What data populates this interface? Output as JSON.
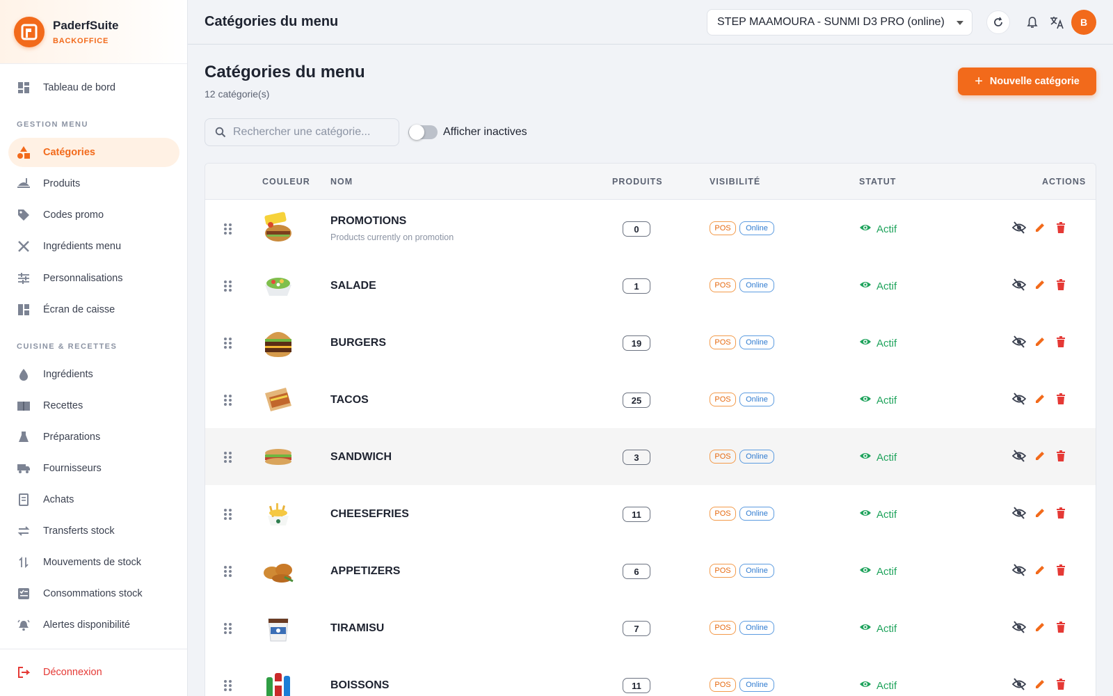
{
  "app": {
    "name": "PaderfSuite",
    "subtitle": "BACKOFFICE",
    "accent": "#f26a1b"
  },
  "sidebar": {
    "top_item": {
      "label": "Tableau de bord",
      "icon": "dashboard-icon"
    },
    "sections": [
      {
        "title": "GESTION MENU",
        "items": [
          {
            "label": "Catégories",
            "icon": "shapes-icon",
            "active": true
          },
          {
            "label": "Produits",
            "icon": "food-tray-icon"
          },
          {
            "label": "Codes promo",
            "icon": "tag-icon"
          },
          {
            "label": "Ingrédients menu",
            "icon": "utensils-icon"
          },
          {
            "label": "Personnalisations",
            "icon": "tune-icon"
          },
          {
            "label": "Écran de caisse",
            "icon": "layout-icon"
          }
        ]
      },
      {
        "title": "CUISINE & RECETTES",
        "items": [
          {
            "label": "Ingrédients",
            "icon": "drop-icon"
          },
          {
            "label": "Recettes",
            "icon": "book-icon"
          },
          {
            "label": "Préparations",
            "icon": "flask-icon"
          },
          {
            "label": "Fournisseurs",
            "icon": "truck-icon"
          },
          {
            "label": "Achats",
            "icon": "receipt-icon"
          },
          {
            "label": "Transferts stock",
            "icon": "swap-icon"
          },
          {
            "label": "Mouvements de stock",
            "icon": "arrows-vertical-icon"
          },
          {
            "label": "Consommations stock",
            "icon": "checklist-icon"
          },
          {
            "label": "Alertes disponibilité",
            "icon": "alarm-icon"
          }
        ]
      }
    ],
    "logout": "Déconnexion"
  },
  "topbar": {
    "title": "Catégories du menu",
    "store": "STEP MAAMOURA - SUNMI D3 PRO (online)",
    "avatar": "B"
  },
  "page": {
    "title": "Catégories du menu",
    "count": "12 catégorie(s)",
    "new_button": "Nouvelle catégorie",
    "search_placeholder": "Rechercher une catégorie...",
    "toggle_label": "Afficher inactives",
    "toggle_on": false
  },
  "table": {
    "headers": {
      "color": "COULEUR",
      "name": "NOM",
      "products": "PRODUITS",
      "visibility": "VISIBILITÉ",
      "status": "STATUT",
      "actions": "ACTIONS"
    },
    "rows": [
      {
        "name": "PROMOTIONS",
        "description": "Products currently on promotion",
        "products": "0",
        "pos": "POS",
        "online": "Online",
        "status": "Actif",
        "image": "promotions-photo"
      },
      {
        "name": "SALADE",
        "description": "",
        "products": "1",
        "pos": "POS",
        "online": "Online",
        "status": "Actif",
        "image": "salad-photo"
      },
      {
        "name": "BURGERS",
        "description": "",
        "products": "19",
        "pos": "POS",
        "online": "Online",
        "status": "Actif",
        "image": "burger-photo"
      },
      {
        "name": "TACOS",
        "description": "",
        "products": "25",
        "pos": "POS",
        "online": "Online",
        "status": "Actif",
        "image": "tacos-photo"
      },
      {
        "name": "SANDWICH",
        "description": "",
        "products": "3",
        "pos": "POS",
        "online": "Online",
        "status": "Actif",
        "image": "sandwich-photo",
        "hover": true
      },
      {
        "name": "CHEESEFRIES",
        "description": "",
        "products": "11",
        "pos": "POS",
        "online": "Online",
        "status": "Actif",
        "image": "cheesefries-photo"
      },
      {
        "name": "APPETIZERS",
        "description": "",
        "products": "6",
        "pos": "POS",
        "online": "Online",
        "status": "Actif",
        "image": "appetizers-photo"
      },
      {
        "name": "TIRAMISU",
        "description": "",
        "products": "7",
        "pos": "POS",
        "online": "Online",
        "status": "Actif",
        "image": "tiramisu-photo"
      },
      {
        "name": "BOISSONS",
        "description": "",
        "products": "11",
        "pos": "POS",
        "online": "Online",
        "status": "Actif",
        "image": "drinks-photo"
      }
    ]
  },
  "colors": {
    "active": "#1fa35c",
    "danger": "#e53935",
    "online": "#2f7bd0"
  }
}
